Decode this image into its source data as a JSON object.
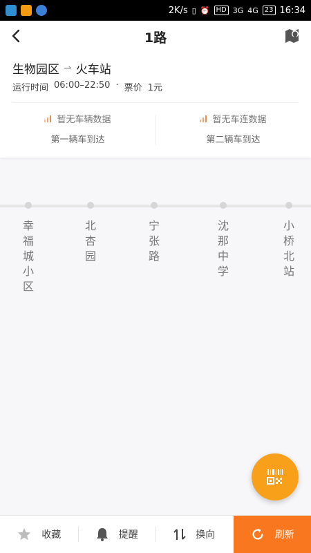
{
  "status_bar": {
    "speed": "2K/s",
    "hd": "HD",
    "net1": "3G",
    "net2": "4G",
    "battery": "23",
    "time": "16:34"
  },
  "header": {
    "title": "1路"
  },
  "route": {
    "from": "生物园区",
    "to": "火车站",
    "hours_label": "运行时间",
    "hours": "06:00–22:50",
    "separator": "·",
    "fare_label": "票价",
    "fare": "1元"
  },
  "vehicles": [
    {
      "status": "暂无车辆数据",
      "label": "第一辆车到达"
    },
    {
      "status": "暂无车连数据",
      "label": "第二辆车到达"
    }
  ],
  "stops": [
    "幸福城小区",
    "北杏园",
    "宁张路",
    "沈那中学",
    "小桥北站"
  ],
  "bottom_bar": {
    "favorite": "收藏",
    "remind": "提醒",
    "reverse": "换向",
    "refresh": "刷新"
  },
  "colors": {
    "accent": "#f9781f",
    "fab": "#f9a01b",
    "signal": "#f08a4b"
  },
  "icons": [
    "back-arrow-icon",
    "map-pin-icon",
    "signal-icon",
    "qr-scan-icon",
    "star-icon",
    "bell-icon",
    "swap-icon",
    "refresh-icon"
  ]
}
